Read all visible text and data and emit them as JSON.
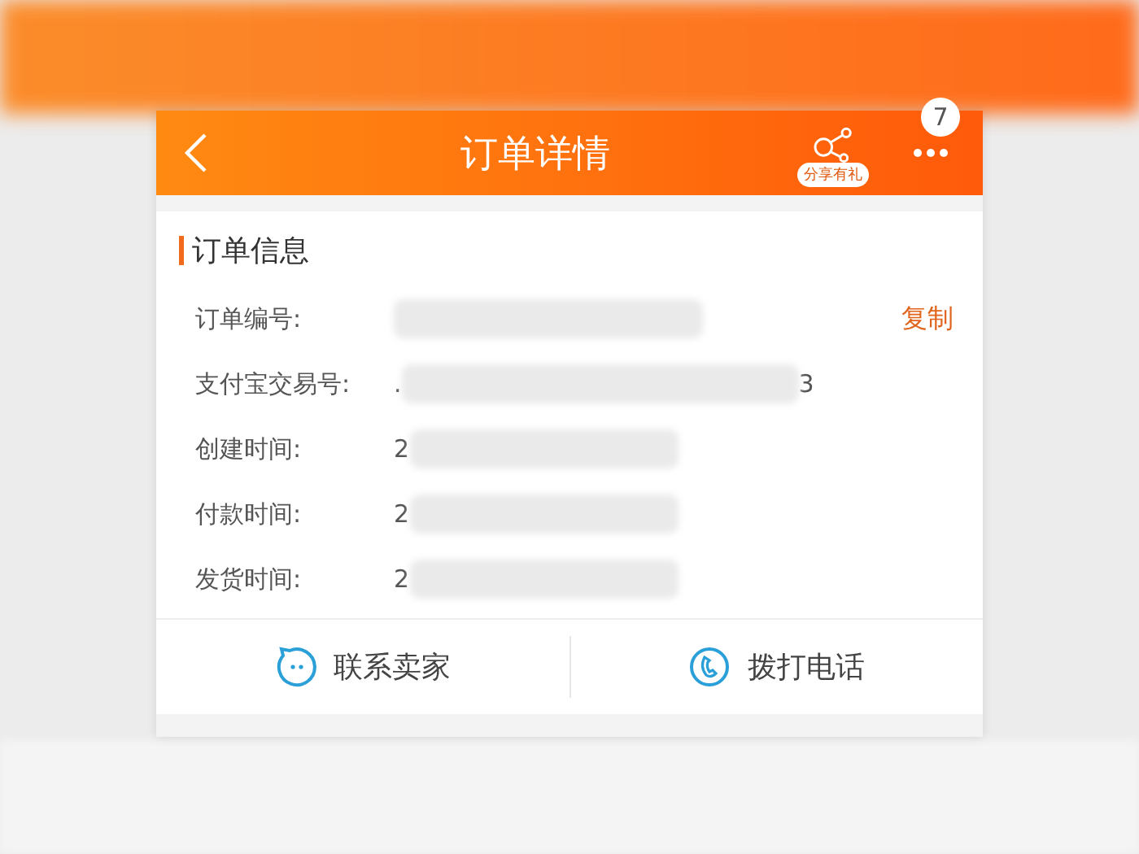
{
  "header": {
    "title": "订单详情",
    "share_label": "分享有礼",
    "badge": "7"
  },
  "section": {
    "title": "订单信息",
    "action": "复制"
  },
  "rows": [
    {
      "label": "订单编号:",
      "value_start": "",
      "value_end": ""
    },
    {
      "label": "支付宝交易号:",
      "value_start": ".",
      "value_end": "3"
    },
    {
      "label": "创建时间:",
      "value_start": "2",
      "value_end": ""
    },
    {
      "label": "付款时间:",
      "value_start": "2",
      "value_end": ""
    },
    {
      "label": "发货时间:",
      "value_start": "2",
      "value_end": ""
    }
  ],
  "actions": [
    {
      "kind": "chat",
      "label": "联系卖家"
    },
    {
      "kind": "phone",
      "label": "拨打电话"
    }
  ]
}
